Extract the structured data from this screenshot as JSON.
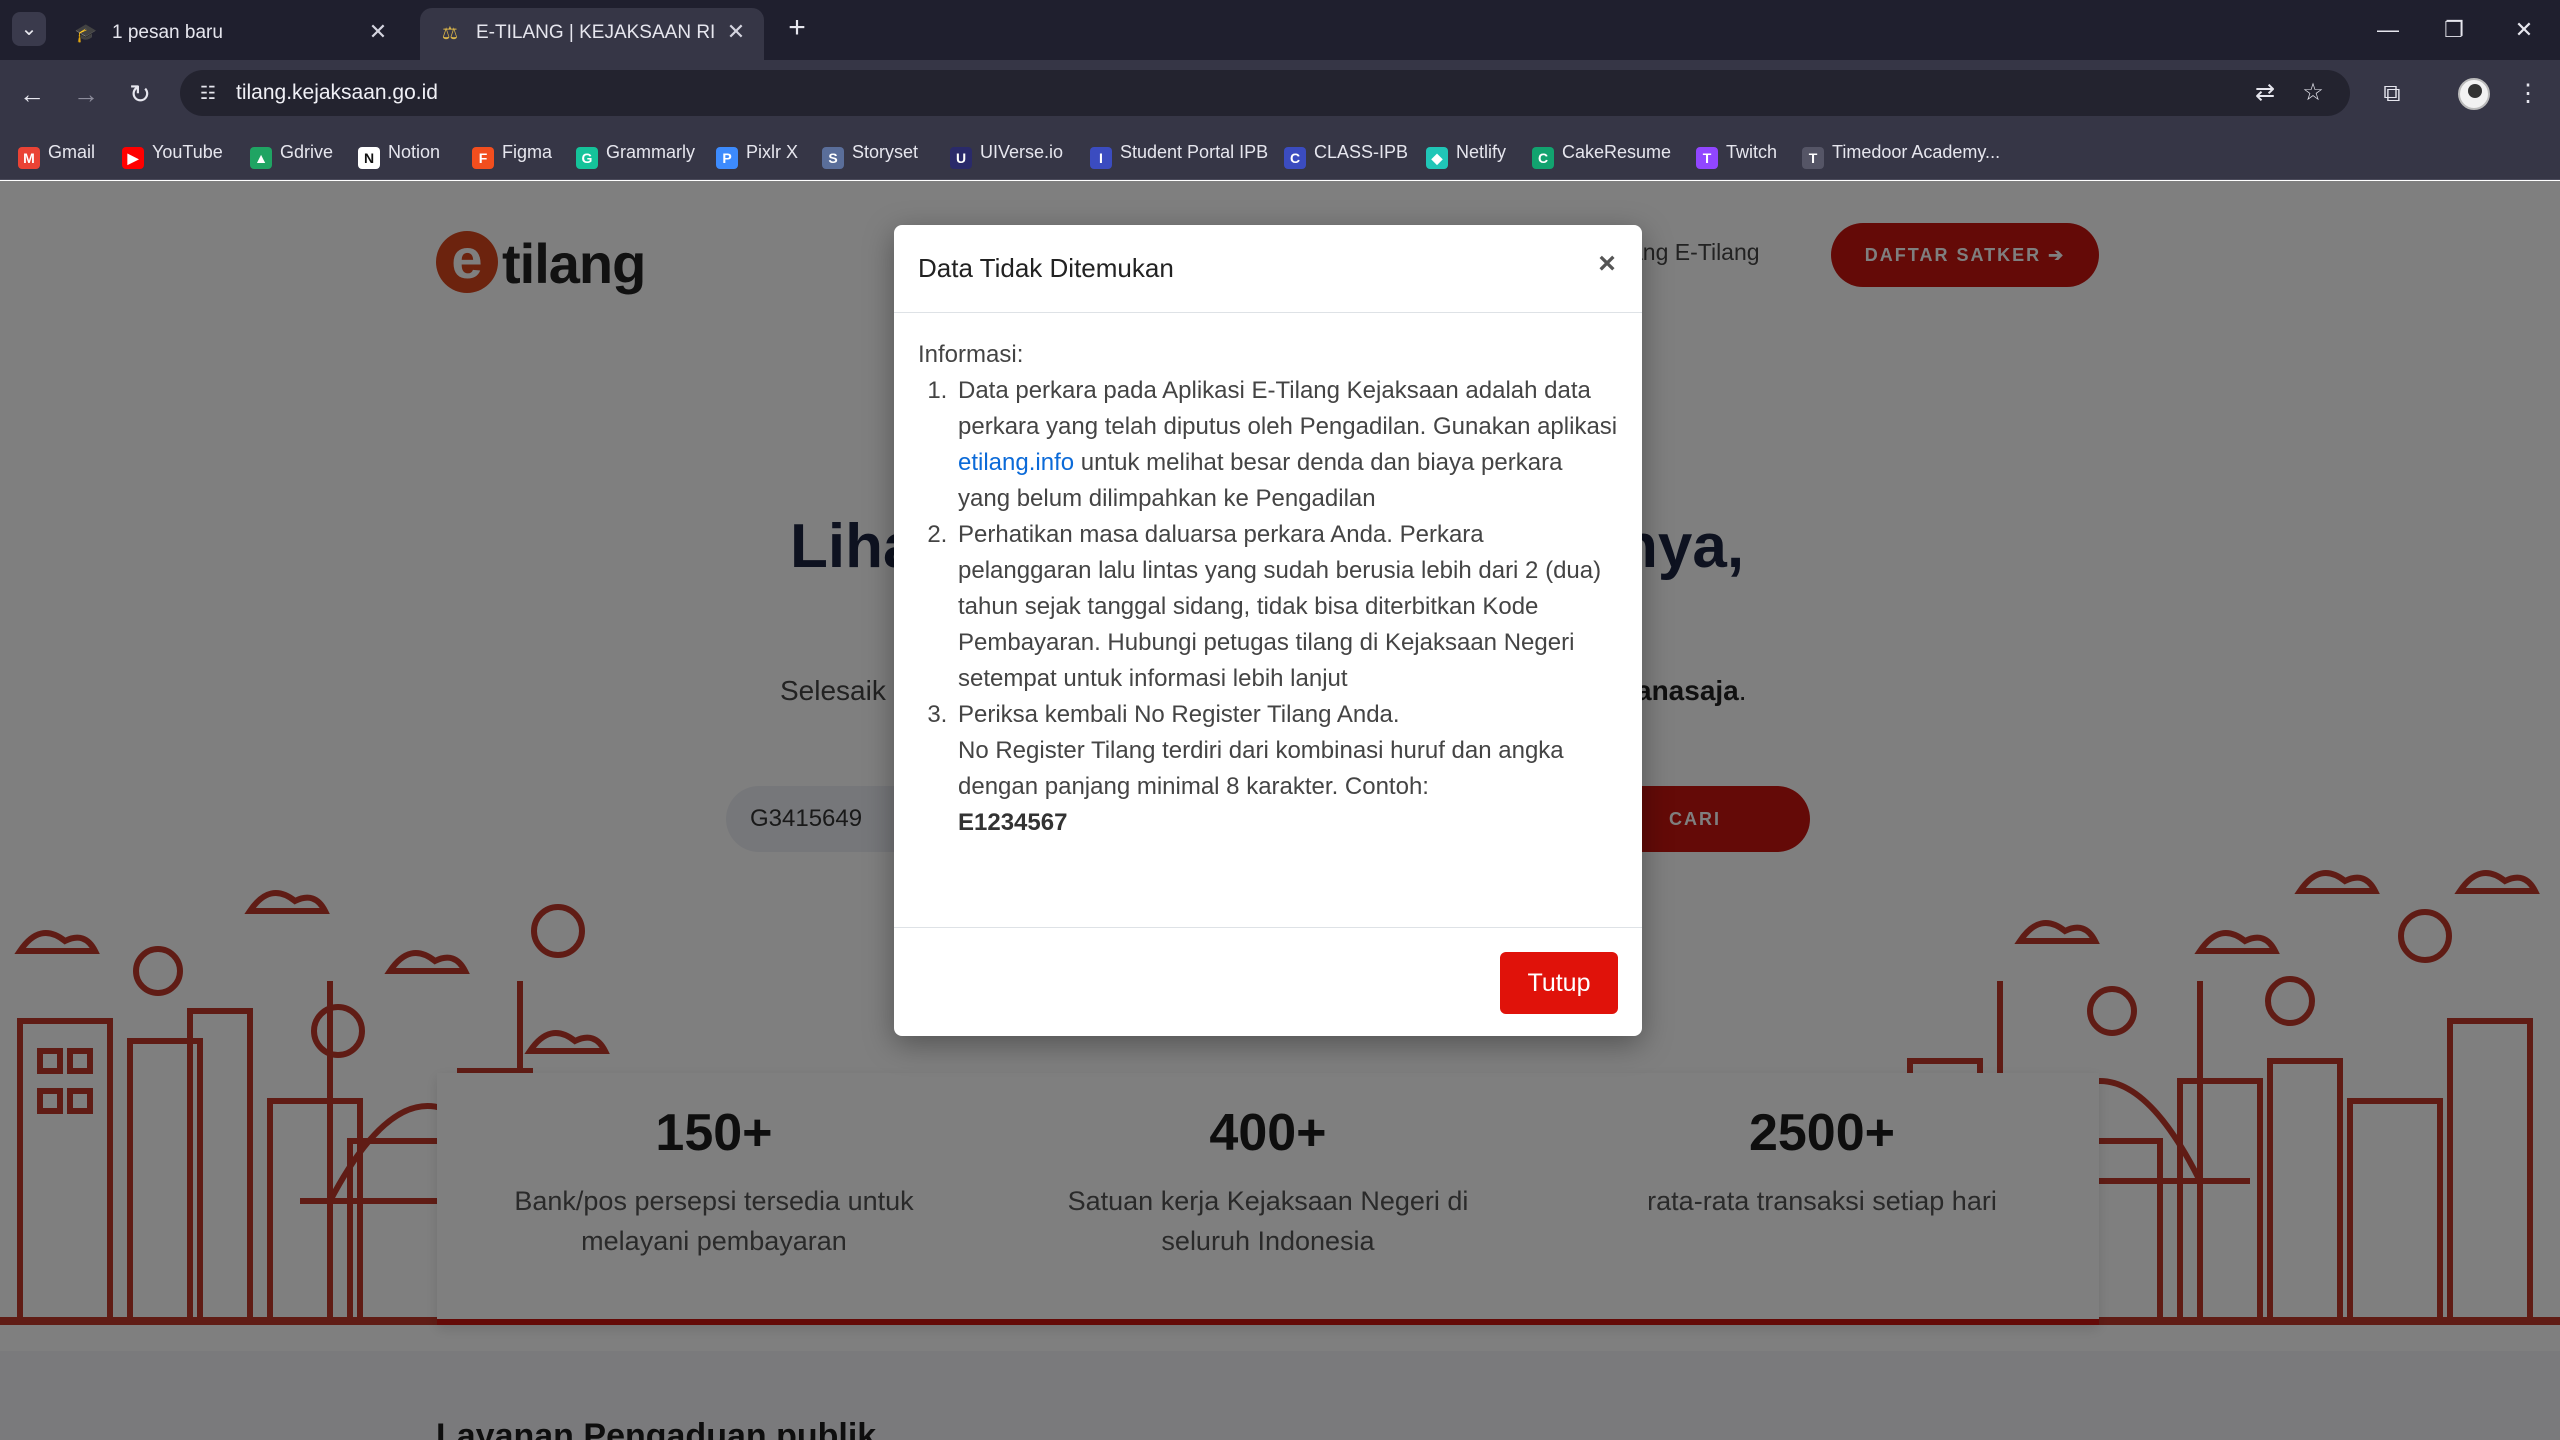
{
  "browser": {
    "tabs": [
      {
        "title": "1 pesan baru",
        "active": false
      },
      {
        "title": "E-TILANG | KEJAKSAAN RI",
        "active": true
      }
    ],
    "url": "tilang.kejaksaan.go.id",
    "bookmarks": [
      {
        "label": "Gmail",
        "icon": "gmail-icon",
        "color": "#ea4335",
        "glyph": "M"
      },
      {
        "label": "YouTube",
        "icon": "youtube-icon",
        "color": "#ff0000",
        "glyph": "▶"
      },
      {
        "label": "Gdrive",
        "icon": "gdrive-icon",
        "color": "#1fa463",
        "glyph": "▲"
      },
      {
        "label": "Notion",
        "icon": "notion-icon",
        "color": "#ffffff",
        "glyph": "N"
      },
      {
        "label": "Figma",
        "icon": "figma-icon",
        "color": "#f24e1e",
        "glyph": "F"
      },
      {
        "label": "Grammarly",
        "icon": "grammarly-icon",
        "color": "#15c39a",
        "glyph": "G"
      },
      {
        "label": "Pixlr X",
        "icon": "pixlr-icon",
        "color": "#3d8bfd",
        "glyph": "P"
      },
      {
        "label": "Storyset",
        "icon": "storyset-icon",
        "color": "#5a6e9a",
        "glyph": "S"
      },
      {
        "label": "UIVerse.io",
        "icon": "uiverse-icon",
        "color": "#2a2a6a",
        "glyph": "U"
      },
      {
        "label": "Student Portal IPB",
        "icon": "ipb-icon",
        "color": "#3b4cc0",
        "glyph": "I"
      },
      {
        "label": "CLASS-IPB",
        "icon": "class-ipb-icon",
        "color": "#3b4cc0",
        "glyph": "C"
      },
      {
        "label": "Netlify",
        "icon": "netlify-icon",
        "color": "#20c6b7",
        "glyph": "◆"
      },
      {
        "label": "CakeResume",
        "icon": "cakeresume-icon",
        "color": "#12a36f",
        "glyph": "C"
      },
      {
        "label": "Twitch",
        "icon": "twitch-icon",
        "color": "#9146ff",
        "glyph": "T"
      },
      {
        "label": "Timedoor Academy...",
        "icon": "timedoor-icon",
        "color": "#555566",
        "glyph": "T"
      }
    ]
  },
  "site": {
    "logo_text": "tilang",
    "logo_letter": "e",
    "nav_link": "ang E-Tilang",
    "daftar_button": "DAFTAR SATKER ➔",
    "hero_title_left": "Liha",
    "hero_title_right": "nya,",
    "hero_sub_left": "Selesaik",
    "hero_sub_right_bold": "anasaja",
    "hero_sub_right_end": ".",
    "search_value": "G3415649",
    "cari_button": "CARI",
    "stats": [
      {
        "number": "150+",
        "desc": "Bank/pos persepsi tersedia untuk melayani pembayaran"
      },
      {
        "number": "400+",
        "desc": "Satuan kerja Kejaksaan Negeri di seluruh Indonesia"
      },
      {
        "number": "2500+",
        "desc": "rata-rata transaksi setiap hari"
      }
    ],
    "section_title": "Layanan Pengaduan publik"
  },
  "modal": {
    "title": "Data Tidak Ditemukan",
    "close_glyph": "×",
    "intro": "Informasi:",
    "item1_a": "Data perkara pada Aplikasi E-Tilang Kejaksaan adalah data perkara yang telah diputus oleh Pengadilan. Gunakan aplikasi ",
    "item1_link": "etilang.info",
    "item1_b": " untuk melihat besar denda dan biaya perkara yang belum dilimpahkan ke Pengadilan",
    "item2": "Perhatikan masa daluarsa perkara Anda. Perkara pelanggaran lalu lintas yang sudah berusia lebih dari 2 (dua) tahun sejak tanggal sidang, tidak bisa diterbitkan Kode Pembayaran. Hubungi petugas tilang di Kejaksaan Negeri setempat untuk informasi lebih lanjut",
    "item3_a": "Periksa kembali No Register Tilang Anda.",
    "item3_b": "No Register Tilang terdiri dari kombinasi huruf dan angka dengan panjang minimal 8 karakter. Contoh:",
    "item3_example": "E1234567",
    "close_button": "Tutup"
  },
  "colors": {
    "brand_red": "#c8150e",
    "button_red": "#e0120a",
    "link_blue": "#0b6ad8",
    "city_red": "#c0392b"
  }
}
